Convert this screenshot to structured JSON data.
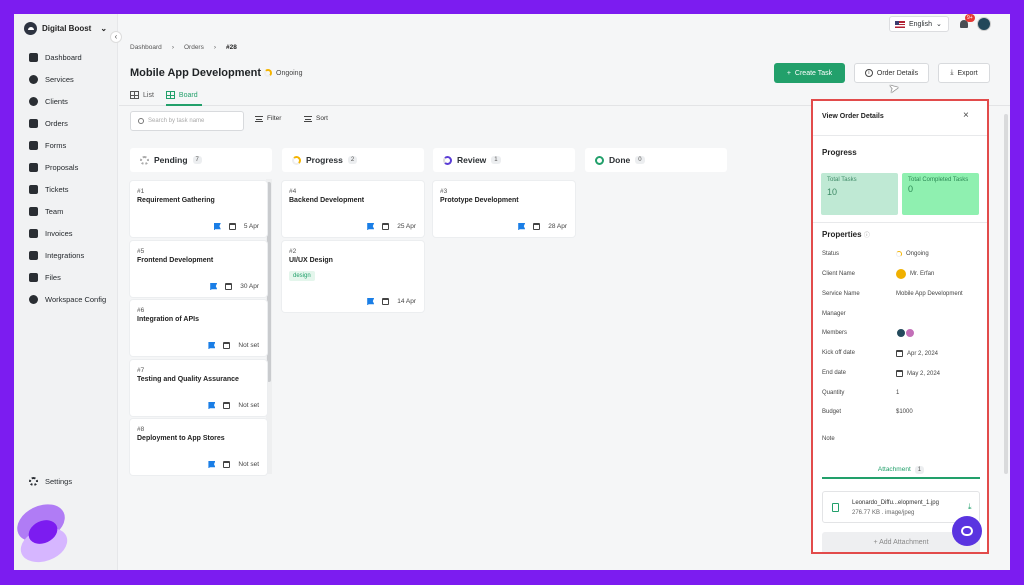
{
  "brand": {
    "name": "Digital Boost"
  },
  "sidebar": {
    "items": [
      {
        "label": "Dashboard",
        "icon": "dashboard-icon"
      },
      {
        "label": "Services",
        "icon": "services-icon"
      },
      {
        "label": "Clients",
        "icon": "clients-icon"
      },
      {
        "label": "Orders",
        "icon": "orders-icon"
      },
      {
        "label": "Forms",
        "icon": "forms-icon"
      },
      {
        "label": "Proposals",
        "icon": "proposals-icon"
      },
      {
        "label": "Tickets",
        "icon": "tickets-icon"
      },
      {
        "label": "Team",
        "icon": "team-icon"
      },
      {
        "label": "Invoices",
        "icon": "invoices-icon"
      },
      {
        "label": "Integrations",
        "icon": "integrations-icon"
      },
      {
        "label": "Files",
        "icon": "files-icon"
      },
      {
        "label": "Workspace Config",
        "icon": "workspace-config-icon"
      }
    ],
    "settings": "Settings"
  },
  "topbar": {
    "language": "English",
    "notifications": "9+"
  },
  "breadcrumb": {
    "items": [
      "Dashboard",
      "Orders",
      "#28"
    ]
  },
  "header": {
    "title": "Mobile App Development",
    "status": "Ongoing",
    "create_label": "Create Task",
    "order_details_label": "Order Details",
    "export_label": "Export"
  },
  "views": {
    "list": "List",
    "board": "Board"
  },
  "toolbar": {
    "search_placeholder": "Search by task name",
    "filter": "Filter",
    "sort": "Sort"
  },
  "board": {
    "columns": [
      {
        "name": "Pending",
        "count": "7"
      },
      {
        "name": "Progress",
        "count": "2"
      },
      {
        "name": "Review",
        "count": "1"
      },
      {
        "name": "Done",
        "count": "0"
      }
    ],
    "pending": [
      {
        "num": "#1",
        "name": "Requirement Gathering",
        "date": "5 Apr"
      },
      {
        "num": "#5",
        "name": "Frontend Development",
        "date": "30 Apr"
      },
      {
        "num": "#6",
        "name": "Integration of APIs",
        "date": "Not set"
      },
      {
        "num": "#7",
        "name": "Testing and Quality Assurance",
        "date": "Not set"
      },
      {
        "num": "#8",
        "name": "Deployment to App Stores",
        "date": "Not set"
      }
    ],
    "progress": [
      {
        "num": "#4",
        "name": "Backend Development",
        "date": "25 Apr"
      },
      {
        "num": "#2",
        "name": "UI/UX Design",
        "tag": "design",
        "date": "14 Apr"
      }
    ],
    "review": [
      {
        "num": "#3",
        "name": "Prototype Development",
        "date": "28 Apr"
      }
    ]
  },
  "panel": {
    "title": "View Order Details",
    "progress_title": "Progress",
    "total_tasks_label": "Total Tasks",
    "total_tasks": "10",
    "completed_label": "Total Completed Tasks",
    "completed": "0",
    "properties_title": "Properties",
    "rows": [
      {
        "label": "Status",
        "value": "Ongoing"
      },
      {
        "label": "Client Name",
        "value": "Mr. Erfan"
      },
      {
        "label": "Service Name",
        "value": "Mobile App Development"
      },
      {
        "label": "Manager",
        "value": ""
      },
      {
        "label": "Members",
        "value": ""
      },
      {
        "label": "Kick off date",
        "value": "Apr 2, 2024"
      },
      {
        "label": "End date",
        "value": "May 2, 2024"
      },
      {
        "label": "Quantity",
        "value": "1"
      },
      {
        "label": "Budget",
        "value": "$1000"
      },
      {
        "label": "Note",
        "value": ""
      }
    ],
    "attachment_tab": "Attachment",
    "attachment_count": "1",
    "file_name": "Leonardo_Diffu...elopment_1.jpg",
    "file_meta": "276.77 KB . image/jpeg",
    "add_attachment": "+ Add Attachment"
  },
  "colors": {
    "accent": "#22a06b",
    "frame": "#7c1cf0",
    "highlight": "#e24b4b",
    "chat": "#5a34e0"
  }
}
